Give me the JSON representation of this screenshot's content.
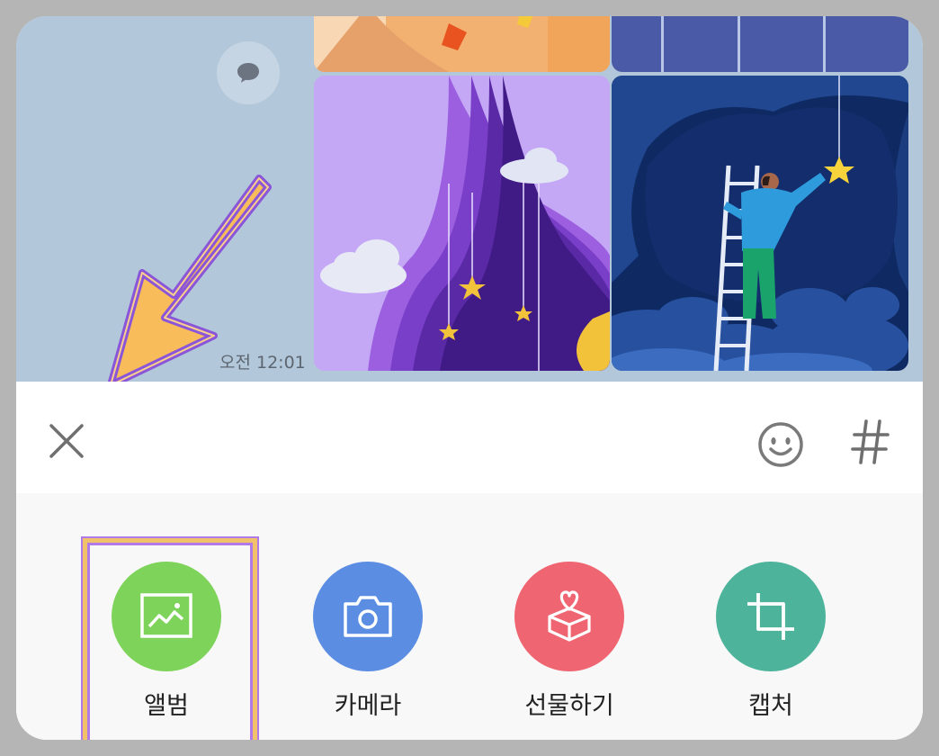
{
  "chat": {
    "timestamp": "오전 12:01"
  },
  "toolbar": {
    "close_icon": "close-icon",
    "emoji_icon": "emoji-icon",
    "hash_icon": "hashtag-icon"
  },
  "attach_actions": [
    {
      "label": "앨범",
      "icon": "image-icon",
      "color": "#7ed35a"
    },
    {
      "label": "카메라",
      "icon": "camera-icon",
      "color": "#5b8de3"
    },
    {
      "label": "선물하기",
      "icon": "gift-icon",
      "color": "#ef6571"
    },
    {
      "label": "캡처",
      "icon": "crop-icon",
      "color": "#4db39a"
    }
  ],
  "colors": {
    "highlight_border": "#f2c26a",
    "highlight_outline": "#b07ae8",
    "chat_background": "#b2c7da"
  }
}
